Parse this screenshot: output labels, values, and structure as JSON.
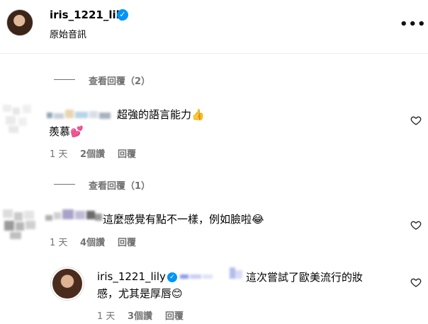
{
  "header": {
    "username": "iris_1221_lily",
    "subtitle": "原始音訊",
    "more_glyph": "•••",
    "verified_glyph": "✓"
  },
  "threads": [
    {
      "view_replies": "查看回覆（2）",
      "comment": {
        "text_line1": "超強的語言能力👍",
        "text_line2": "羨慕💕",
        "time": "1 天",
        "likes": "2個讚",
        "reply": "回覆"
      }
    },
    {
      "view_replies": "查看回覆（1）",
      "comment": {
        "text_line1": "這麼感覺有點不一樣，例如臉啦😂",
        "time": "1 天",
        "likes": "4個讚",
        "reply": "回覆"
      },
      "reply": {
        "username": "iris_1221_lily",
        "text_line1": "這次嘗試了歐美流行的妝",
        "text_line2": "感，尤其是厚唇😊",
        "time": "1 天",
        "likes": "3個讚",
        "reply": "回覆"
      }
    }
  ],
  "icons": {
    "heart": "heart-outline-icon",
    "verified": "verified-badge-icon"
  },
  "colors": {
    "verified_blue": "#0095f6",
    "muted_text": "#737373"
  }
}
